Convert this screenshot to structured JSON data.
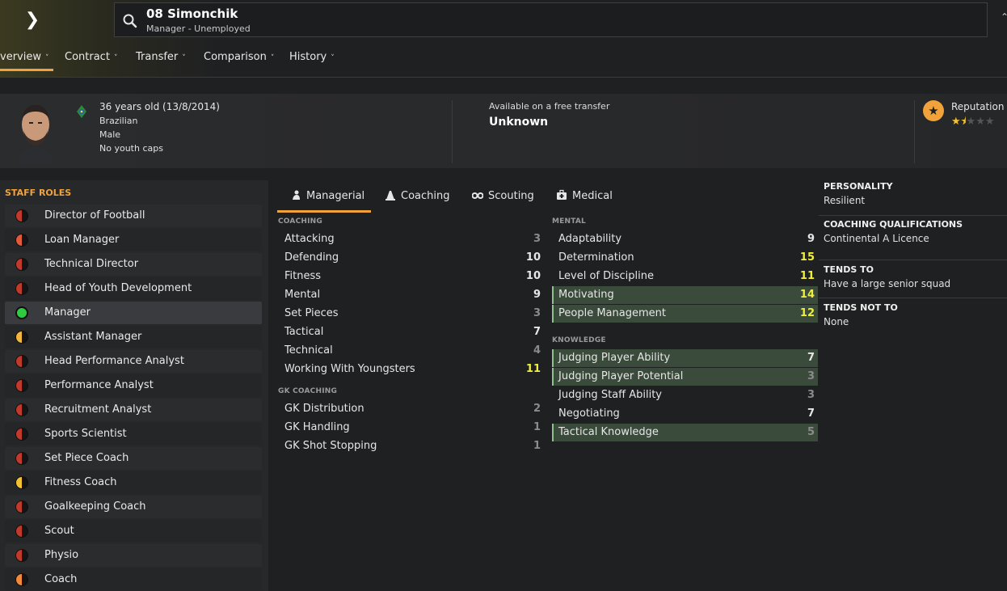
{
  "header": {
    "name": "08 Simonchik",
    "subtitle": "Manager - Unemployed",
    "tabs": [
      {
        "label": "Overview",
        "visible_label": "verview",
        "active": true
      },
      {
        "label": "Contract"
      },
      {
        "label": "Transfer"
      },
      {
        "label": "Comparison"
      },
      {
        "label": "History"
      }
    ]
  },
  "info": {
    "age": "36 years old (13/8/2014)",
    "nationality": "Brazilian",
    "gender": "Male",
    "youth": "No youth caps",
    "availability_label": "Available on a free transfer",
    "value": "Unknown",
    "reputation_label": "Reputation",
    "reputation_stars": 1.5
  },
  "roles": {
    "title": "STAFF ROLES",
    "items": [
      {
        "label": "Director of Football",
        "color": "#c0392b"
      },
      {
        "label": "Loan Manager",
        "color": "#e05a3a"
      },
      {
        "label": "Technical Director",
        "color": "#c0392b"
      },
      {
        "label": "Head of Youth Development",
        "color": "#c0392b"
      },
      {
        "label": "Manager",
        "color": "#2ecc40",
        "selected": true
      },
      {
        "label": "Assistant Manager",
        "color": "#f2b63a"
      },
      {
        "label": "Head Performance Analyst",
        "color": "#c0392b"
      },
      {
        "label": "Performance Analyst",
        "color": "#c0392b"
      },
      {
        "label": "Recruitment Analyst",
        "color": "#c0392b"
      },
      {
        "label": "Sports Scientist",
        "color": "#c0392b"
      },
      {
        "label": "Set Piece Coach",
        "color": "#c0392b"
      },
      {
        "label": "Fitness Coach",
        "color": "#f2c230"
      },
      {
        "label": "Goalkeeping Coach",
        "color": "#c0392b"
      },
      {
        "label": "Scout",
        "color": "#c0392b"
      },
      {
        "label": "Physio",
        "color": "#c0392b"
      },
      {
        "label": "Coach",
        "color": "#f28a3a"
      }
    ]
  },
  "attr_tabs": [
    "Managerial",
    "Coaching",
    "Scouting",
    "Medical"
  ],
  "coaching": {
    "title": "COACHING",
    "rows": [
      {
        "name": "Attacking",
        "value": "3"
      },
      {
        "name": "Defending",
        "value": "10"
      },
      {
        "name": "Fitness",
        "value": "10"
      },
      {
        "name": "Mental",
        "value": "9"
      },
      {
        "name": "Set Pieces",
        "value": "3"
      },
      {
        "name": "Tactical",
        "value": "7"
      },
      {
        "name": "Technical",
        "value": "4"
      },
      {
        "name": "Working With Youngsters",
        "value": "11"
      }
    ]
  },
  "gk": {
    "title": "GK COACHING",
    "rows": [
      {
        "name": "GK Distribution",
        "value": "2"
      },
      {
        "name": "GK Handling",
        "value": "1"
      },
      {
        "name": "GK Shot Stopping",
        "value": "1"
      }
    ]
  },
  "mental": {
    "title": "MENTAL",
    "rows": [
      {
        "name": "Adaptability",
        "value": "9"
      },
      {
        "name": "Determination",
        "value": "15"
      },
      {
        "name": "Level of Discipline",
        "value": "11"
      },
      {
        "name": "Motivating",
        "value": "14",
        "highlight": true
      },
      {
        "name": "People Management",
        "value": "12",
        "highlight": true
      }
    ]
  },
  "knowledge": {
    "title": "KNOWLEDGE",
    "rows": [
      {
        "name": "Judging Player Ability",
        "value": "7",
        "highlight": true
      },
      {
        "name": "Judging Player Potential",
        "value": "3",
        "highlight": true
      },
      {
        "name": "Judging Staff Ability",
        "value": "3"
      },
      {
        "name": "Negotiating",
        "value": "7"
      },
      {
        "name": "Tactical Knowledge",
        "value": "5",
        "highlight": true
      }
    ]
  },
  "side": {
    "personality_h": "PERSONALITY",
    "personality": "Resilient",
    "quals_h": "COACHING QUALIFICATIONS",
    "quals": "Continental A Licence",
    "tends_h": "TENDS TO",
    "tends": "Have a large senior squad",
    "tends_not_h": "TENDS NOT TO",
    "tends_not": "None"
  }
}
